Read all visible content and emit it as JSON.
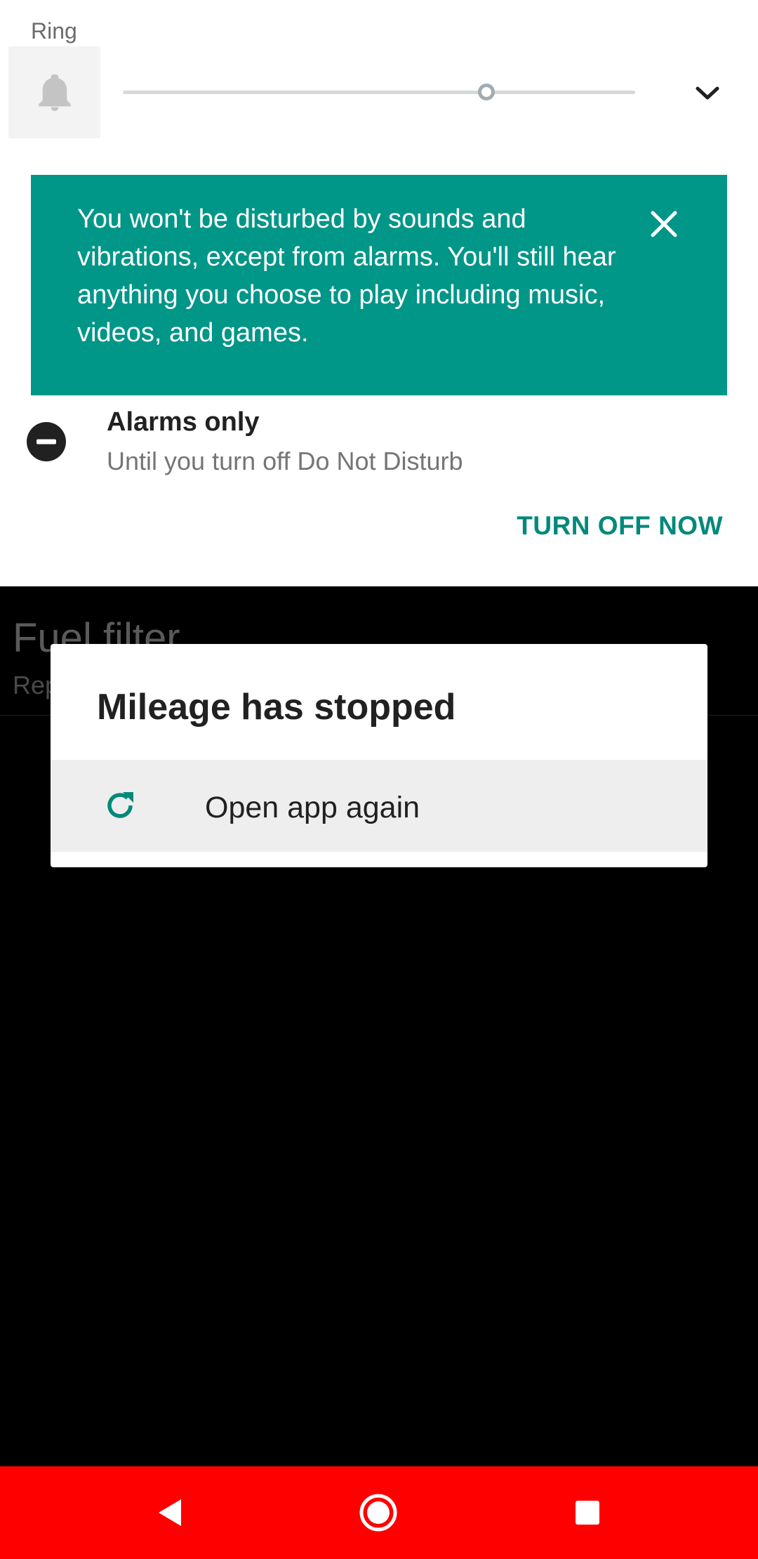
{
  "background_app": {
    "row_title": "Fuel filter",
    "row_subtitle": "Rep"
  },
  "volume_panel": {
    "stream_label": "Ring",
    "ring_level_fraction": 0.71,
    "bell_icon": "bell-icon",
    "expand_icon": "chevron-down-icon"
  },
  "dnd": {
    "banner_text": "You won't be disturbed by sounds and vibrations, except from alarms. You'll still hear anything you choose to play including music, videos, and games.",
    "banner_color": "#009688",
    "close_icon": "close-icon",
    "mode_icon": "do-not-disturb-icon",
    "mode_title": "Alarms only",
    "mode_subtitle": "Until you turn off Do Not Disturb",
    "turn_off_label": "TURN OFF NOW",
    "accent_color": "#00897b"
  },
  "dialog": {
    "title": "Mileage has stopped",
    "action_label": "Open app again",
    "action_icon": "refresh-icon"
  },
  "navbar": {
    "background": "#ff0000",
    "buttons": [
      "back-icon",
      "home-icon",
      "recents-icon"
    ]
  }
}
